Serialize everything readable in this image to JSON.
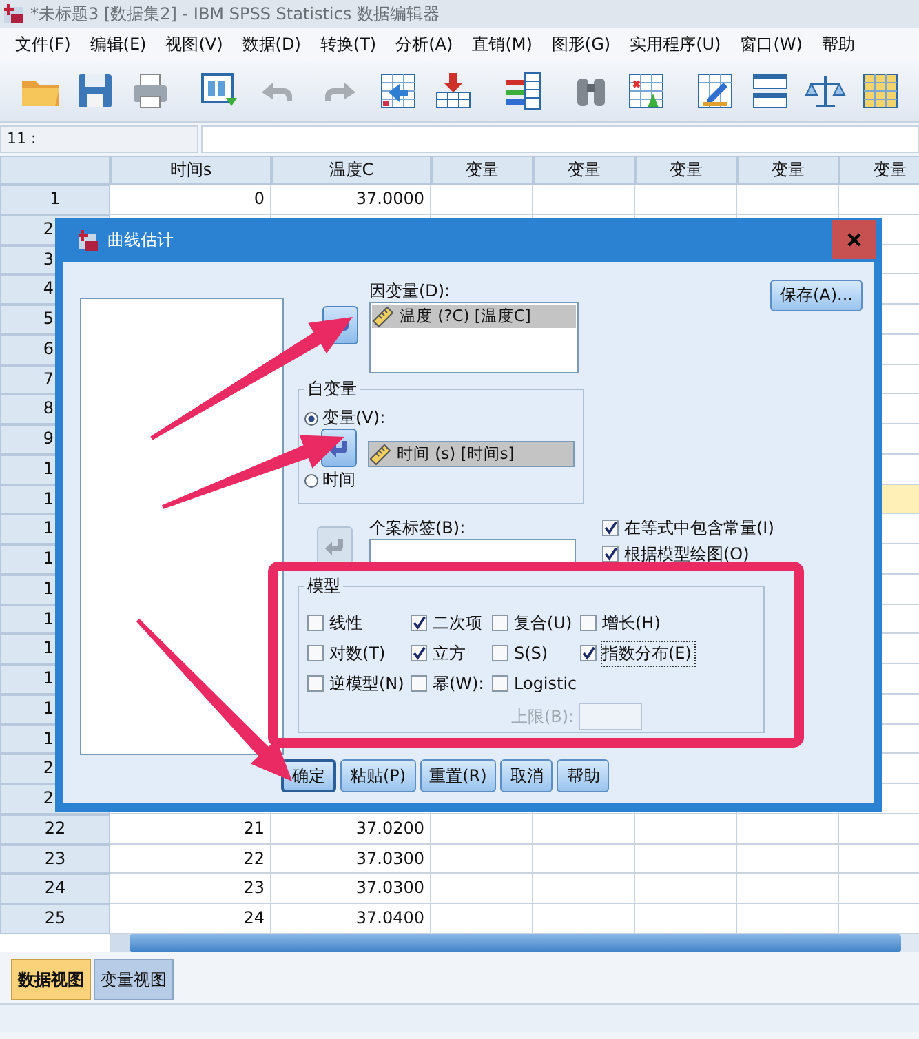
{
  "window": {
    "title": "*未标题3 [数据集2] - IBM SPSS Statistics 数据编辑器"
  },
  "menu": [
    "文件(F)",
    "编辑(E)",
    "视图(V)",
    "数据(D)",
    "转换(T)",
    "分析(A)",
    "直销(M)",
    "图形(G)",
    "实用程序(U)",
    "窗口(W)",
    "帮助"
  ],
  "cell_reference": "11 :",
  "grid": {
    "columns": [
      "时间s",
      "温度C",
      "变量",
      "变量",
      "变量",
      "变量",
      "变量"
    ],
    "rows": [
      {
        "label": "1",
        "cells": [
          "0",
          "37.0000"
        ]
      },
      {
        "label": "2"
      },
      {
        "label": "3"
      },
      {
        "label": "4"
      },
      {
        "label": "5"
      },
      {
        "label": "6"
      },
      {
        "label": "7"
      },
      {
        "label": "8"
      },
      {
        "label": "9"
      },
      {
        "label": "1"
      },
      {
        "label": "1",
        "highlighted": true
      },
      {
        "label": "1"
      },
      {
        "label": "1"
      },
      {
        "label": "1"
      },
      {
        "label": "1"
      },
      {
        "label": "1"
      },
      {
        "label": "1"
      },
      {
        "label": "1"
      },
      {
        "label": "1"
      },
      {
        "label": "2"
      },
      {
        "label": "2"
      },
      {
        "label": "22",
        "cells": [
          "21",
          "37.0200"
        ]
      },
      {
        "label": "23",
        "cells": [
          "22",
          "37.0300"
        ]
      },
      {
        "label": "24",
        "cells": [
          "23",
          "37.0300"
        ]
      },
      {
        "label": "25",
        "cells": [
          "24",
          "37.0400"
        ]
      }
    ]
  },
  "dialog": {
    "title": "曲线估计",
    "save_button": "保存(A)...",
    "dependent": {
      "label": "因变量(D):",
      "arrow": {
        "disabled": false
      },
      "items": [
        {
          "text": "温度 (?C) [温度C]",
          "selected": true
        }
      ]
    },
    "independent": {
      "title": "自变量",
      "arrow": {
        "disabled": false
      },
      "options": [
        {
          "label": "变量(V):",
          "selected": true
        },
        {
          "label": "时间",
          "selected": false
        }
      ],
      "items": [
        {
          "text": "时间 (s) [时间s]",
          "selected": true
        }
      ]
    },
    "case_labels": {
      "label": "个案标签(B):",
      "arrow": {
        "disabled": true
      }
    },
    "options": [
      {
        "label": "在等式中包含常量(I)",
        "checked": true
      },
      {
        "label": "根据模型绘图(O)",
        "checked": true
      }
    ],
    "models": {
      "title": "模型",
      "items": [
        {
          "label": "线性",
          "checked": false
        },
        {
          "label": "二次项",
          "checked": true
        },
        {
          "label": "复合(U)",
          "checked": false
        },
        {
          "label": "增长(H)",
          "checked": false
        },
        {
          "label": "对数(T)",
          "checked": false
        },
        {
          "label": "立方",
          "checked": true
        },
        {
          "label": "S(S)",
          "checked": false
        },
        {
          "label": "指数分布(E)",
          "checked": true,
          "focused": true
        },
        {
          "label": "逆模型(N)",
          "checked": false
        },
        {
          "label": "幂(W):",
          "checked": false
        },
        {
          "label": "Logistic",
          "checked": false
        }
      ],
      "upper_bound": {
        "label": "上限(B):",
        "disabled": true
      }
    },
    "buttons": [
      {
        "label": "确定",
        "default": true
      },
      {
        "label": "粘贴(P)",
        "default": false
      },
      {
        "label": "重置(R)",
        "default": false
      },
      {
        "label": "取消",
        "default": false
      },
      {
        "label": "帮助",
        "default": false
      }
    ]
  },
  "tabs": [
    {
      "label": "数据视图",
      "selected": true
    },
    {
      "label": "变量视图",
      "selected": false
    }
  ]
}
